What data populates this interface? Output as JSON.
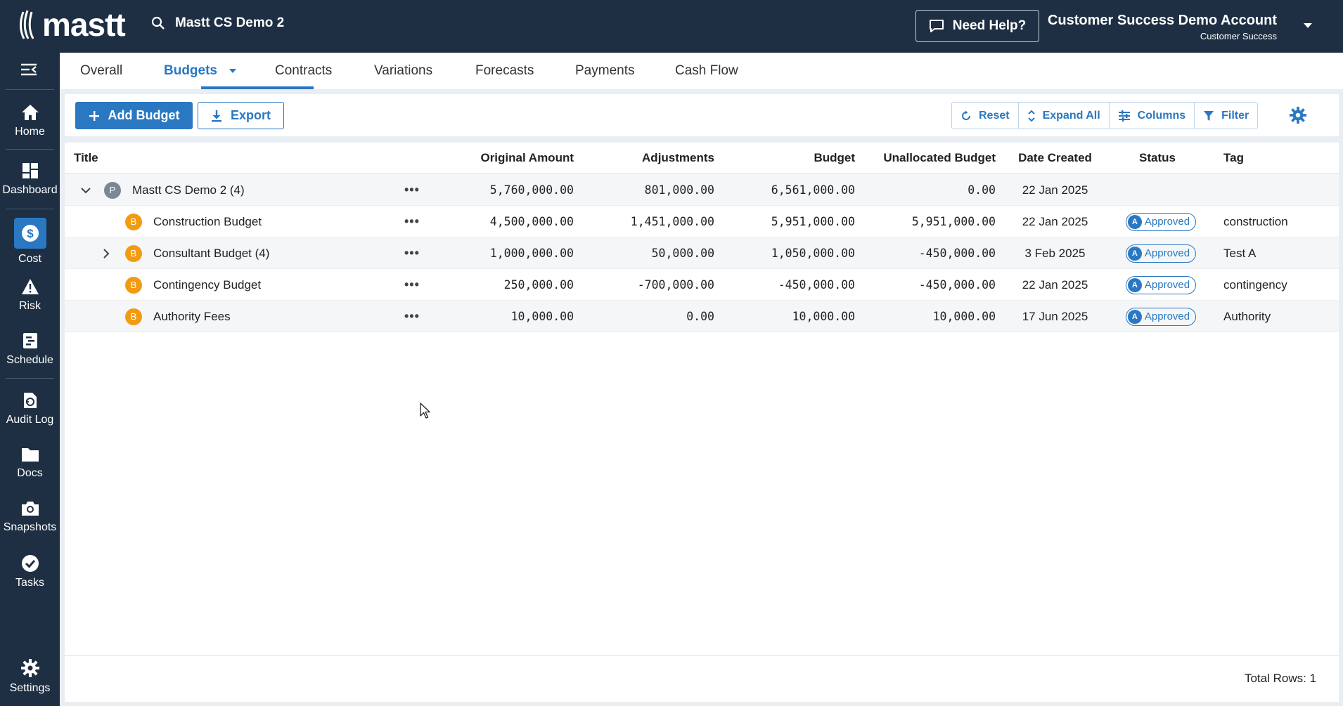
{
  "app": {
    "logo": "mastt",
    "project": "Mastt CS Demo 2",
    "help_label": "Need Help?",
    "account_name": "Customer Success Demo Account",
    "account_role": "Customer Success"
  },
  "sidebar": {
    "items": [
      {
        "label": "Home",
        "icon": "home-icon"
      },
      {
        "label": "Dashboard",
        "icon": "dashboard-icon"
      },
      {
        "label": "Cost",
        "icon": "dollar-icon"
      },
      {
        "label": "Risk",
        "icon": "warning-icon"
      },
      {
        "label": "Schedule",
        "icon": "schedule-icon"
      },
      {
        "label": "Audit Log",
        "icon": "audit-log-icon"
      },
      {
        "label": "Docs",
        "icon": "folder-icon"
      },
      {
        "label": "Snapshots",
        "icon": "camera-icon"
      },
      {
        "label": "Tasks",
        "icon": "check-circle-icon"
      },
      {
        "label": "Settings",
        "icon": "gear-icon"
      }
    ]
  },
  "tabs": [
    "Overall",
    "Budgets",
    "Contracts",
    "Variations",
    "Forecasts",
    "Payments",
    "Cash Flow"
  ],
  "toolbar": {
    "add_label": "Add Budget",
    "export_label": "Export",
    "reset_label": "Reset",
    "expand_label": "Expand All",
    "columns_label": "Columns",
    "filter_label": "Filter"
  },
  "table": {
    "headers": [
      "Title",
      "Original Amount",
      "Adjustments",
      "Budget",
      "Unallocated Budget",
      "Date Created",
      "Status",
      "Tag"
    ],
    "rows": [
      {
        "badge": "P",
        "title": "Mastt CS Demo 2",
        "count": "(4)",
        "original": "5,760,000.00",
        "adjustments": "801,000.00",
        "budget": "6,561,000.00",
        "unallocated": "0.00",
        "date": "22 Jan 2025",
        "status": "",
        "status_badge": "",
        "tag": ""
      },
      {
        "badge": "B",
        "title": "Construction Budget",
        "count": "",
        "original": "4,500,000.00",
        "adjustments": "1,451,000.00",
        "budget": "5,951,000.00",
        "unallocated": "5,951,000.00",
        "date": "22 Jan 2025",
        "status": "Approved",
        "status_badge": "A",
        "tag": "construction"
      },
      {
        "badge": "B",
        "title": "Consultant Budget",
        "count": "(4)",
        "original": "1,000,000.00",
        "adjustments": "50,000.00",
        "budget": "1,050,000.00",
        "unallocated": "-450,000.00",
        "date": "3 Feb 2025",
        "status": "Approved",
        "status_badge": "A",
        "tag": "Test A"
      },
      {
        "badge": "B",
        "title": "Contingency Budget",
        "count": "",
        "original": "250,000.00",
        "adjustments": "-700,000.00",
        "budget": "-450,000.00",
        "unallocated": "-450,000.00",
        "date": "22 Jan 2025",
        "status": "Approved",
        "status_badge": "A",
        "tag": "contingency"
      },
      {
        "badge": "B",
        "title": "Authority Fees",
        "count": "",
        "original": "10,000.00",
        "adjustments": "0.00",
        "budget": "10,000.00",
        "unallocated": "10,000.00",
        "date": "17 Jun 2025",
        "status": "Approved",
        "status_badge": "A",
        "tag": "Authority"
      }
    ],
    "footer": "Total Rows: 1"
  }
}
